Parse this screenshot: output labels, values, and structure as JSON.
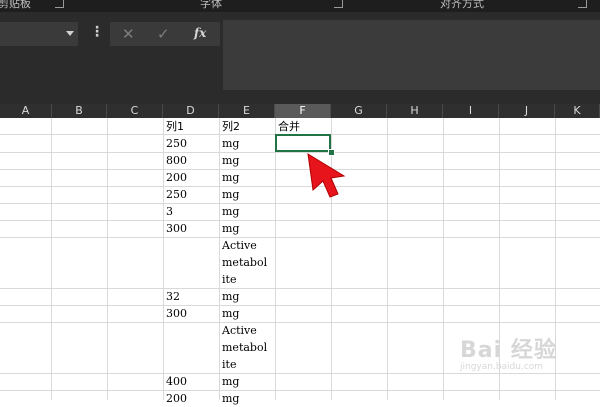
{
  "ribbon": {
    "groups": [
      {
        "label": "剪贴板"
      },
      {
        "label": "字体"
      },
      {
        "label": "对齐方式"
      }
    ]
  },
  "formula_bar": {
    "name_box_value": "",
    "more_label": "⋮",
    "cancel_label": "✕",
    "enter_label": "✓",
    "fx_label": "fx",
    "formula_value": ""
  },
  "columns": [
    "A",
    "B",
    "C",
    "D",
    "E",
    "F",
    "G",
    "H",
    "I",
    "J",
    "K"
  ],
  "selected_column": "F",
  "header_row": {
    "D": "列1",
    "E": "列2",
    "F": "合并"
  },
  "rows": [
    {
      "D": "250",
      "E": [
        "mg"
      ]
    },
    {
      "D": "800",
      "E": [
        "mg"
      ]
    },
    {
      "D": "200",
      "E": [
        "mg"
      ]
    },
    {
      "D": "250",
      "E": [
        "mg"
      ]
    },
    {
      "D": "3",
      "E": [
        "mg"
      ]
    },
    {
      "D": "300",
      "E": [
        "mg"
      ]
    },
    {
      "D": "",
      "E": [
        "Active",
        "metabol",
        "ite"
      ]
    },
    {
      "D": "32",
      "E": [
        "mg"
      ]
    },
    {
      "D": "300",
      "E": [
        "mg"
      ]
    },
    {
      "D": "",
      "E": [
        "Active",
        "metabol",
        "ite"
      ]
    },
    {
      "D": "400",
      "E": [
        "mg"
      ]
    },
    {
      "D": "200",
      "E": [
        "mg"
      ]
    }
  ],
  "colors": {
    "selection": "#217346",
    "pointer": "#e8141b"
  },
  "watermark": {
    "main": "Bai 经验",
    "sub": "jingyan.baidu.com"
  }
}
